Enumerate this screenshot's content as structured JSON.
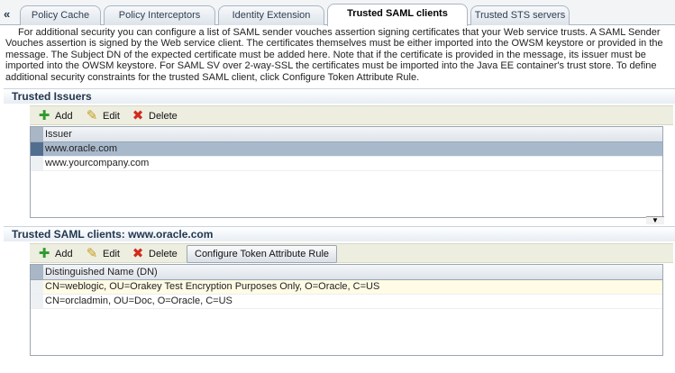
{
  "tabs": {
    "scroll_glyph": "«",
    "items": [
      {
        "label": "Policy Cache"
      },
      {
        "label": "Policy Interceptors"
      },
      {
        "label": "Identity Extension"
      },
      {
        "label": "Trusted SAML clients"
      },
      {
        "label": "Trusted STS servers"
      }
    ],
    "active_index": 3
  },
  "description": "For additional security you can configure a list of SAML sender vouches assertion signing certificates that your Web service trusts. A SAML Sender Vouches assertion is signed by the Web service client. The certificates themselves must be either imported into the OWSM keystore or provided in the message. The Subject DN of the expected certificate must be added here. Note that if the certificate is provided in the message, its issuer must be imported into the OWSM keystore. For SAML SV over 2-way-SSL the certificates must be imported into the Java EE container's trust store. To define additional security constraints for the trusted SAML client, click Configure Token Attribute Rule.",
  "issuers_section": {
    "title": "Trusted Issuers",
    "toolbar": {
      "add": "Add",
      "edit": "Edit",
      "delete": "Delete"
    },
    "table": {
      "header": "Issuer",
      "rows": [
        "www.oracle.com",
        "www.yourcompany.com"
      ],
      "selected_index": 0
    }
  },
  "clients_section": {
    "title": "Trusted SAML clients: www.oracle.com",
    "toolbar": {
      "add": "Add",
      "edit": "Edit",
      "delete": "Delete",
      "configure": "Configure Token Attribute Rule"
    },
    "table": {
      "header": "Distinguished Name (DN)",
      "rows": [
        "CN=weblogic, OU=Orakey Test Encryption Purposes Only, O=Oracle, C=US",
        "CN=orcladmin, OU=Doc, O=Oracle, C=US"
      ],
      "highlighted_index": 0
    }
  },
  "icons": {
    "add": "plus-icon",
    "edit": "pencil-icon",
    "delete": "x-icon",
    "scroll": "scroll-down-icon"
  },
  "colors": {
    "selected_row": "#a9b9cc",
    "highlight_row": "#fffbe4",
    "toolbar_bg": "#edeee0",
    "section_title": "#22374f"
  }
}
